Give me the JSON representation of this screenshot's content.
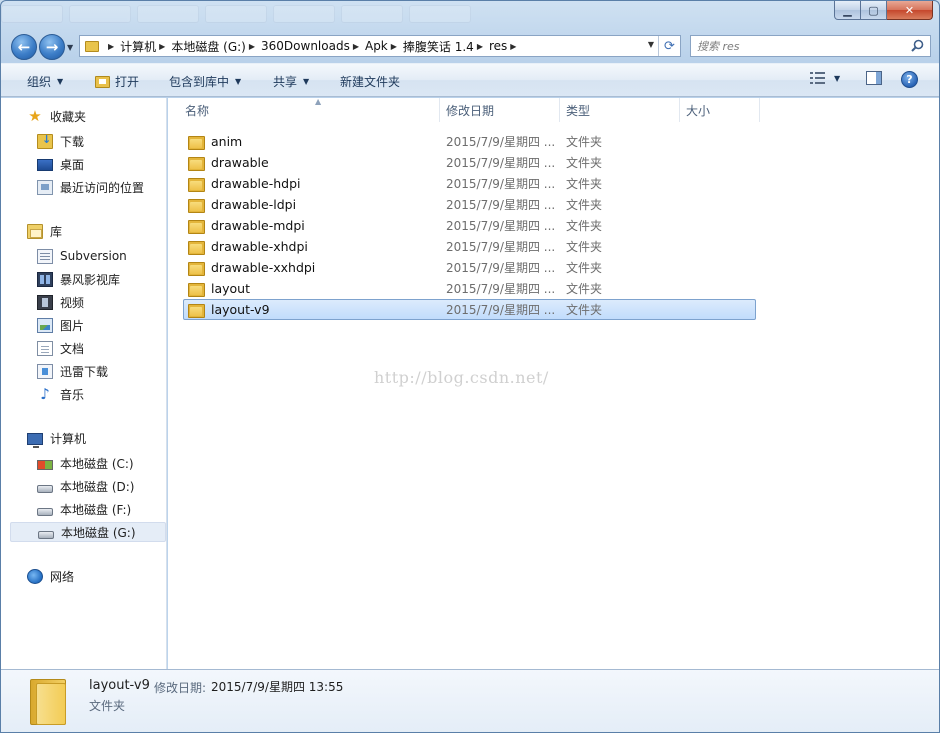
{
  "address": {
    "crumbs": [
      "计算机",
      "本地磁盘 (G:)",
      "360Downloads",
      "Apk",
      "捧腹笑话 1.4",
      "res"
    ]
  },
  "search": {
    "placeholder": "搜索 res"
  },
  "toolbar": {
    "organize": "组织",
    "open": "打开",
    "include_in_library": "包含到库中",
    "share": "共享",
    "new_folder": "新建文件夹"
  },
  "sidebar": {
    "favorites": {
      "label": "收藏夹",
      "items": [
        "下载",
        "桌面",
        "最近访问的位置"
      ]
    },
    "libraries": {
      "label": "库",
      "items": [
        "Subversion",
        "暴风影视库",
        "视频",
        "图片",
        "文档",
        "迅雷下载",
        "音乐"
      ]
    },
    "computer": {
      "label": "计算机",
      "items": [
        "本地磁盘 (C:)",
        "本地磁盘 (D:)",
        "本地磁盘 (F:)",
        "本地磁盘 (G:)"
      ],
      "selected": "本地磁盘 (G:)"
    },
    "network": {
      "label": "网络"
    }
  },
  "columns": {
    "name": "名称",
    "date": "修改日期",
    "type": "类型",
    "size": "大小"
  },
  "files": [
    {
      "name": "anim",
      "date": "2015/7/9/星期四 ...",
      "type": "文件夹"
    },
    {
      "name": "drawable",
      "date": "2015/7/9/星期四 ...",
      "type": "文件夹"
    },
    {
      "name": "drawable-hdpi",
      "date": "2015/7/9/星期四 ...",
      "type": "文件夹"
    },
    {
      "name": "drawable-ldpi",
      "date": "2015/7/9/星期四 ...",
      "type": "文件夹"
    },
    {
      "name": "drawable-mdpi",
      "date": "2015/7/9/星期四 ...",
      "type": "文件夹"
    },
    {
      "name": "drawable-xhdpi",
      "date": "2015/7/9/星期四 ...",
      "type": "文件夹"
    },
    {
      "name": "drawable-xxhdpi",
      "date": "2015/7/9/星期四 ...",
      "type": "文件夹"
    },
    {
      "name": "layout",
      "date": "2015/7/9/星期四 ...",
      "type": "文件夹"
    },
    {
      "name": "layout-v9",
      "date": "2015/7/9/星期四 ...",
      "type": "文件夹"
    }
  ],
  "selected_file": "layout-v9",
  "watermark": "http://blog.csdn.net/",
  "details": {
    "name": "layout-v9",
    "date_label": "修改日期:",
    "date": "2015/7/9/星期四 13:55",
    "type": "文件夹"
  }
}
